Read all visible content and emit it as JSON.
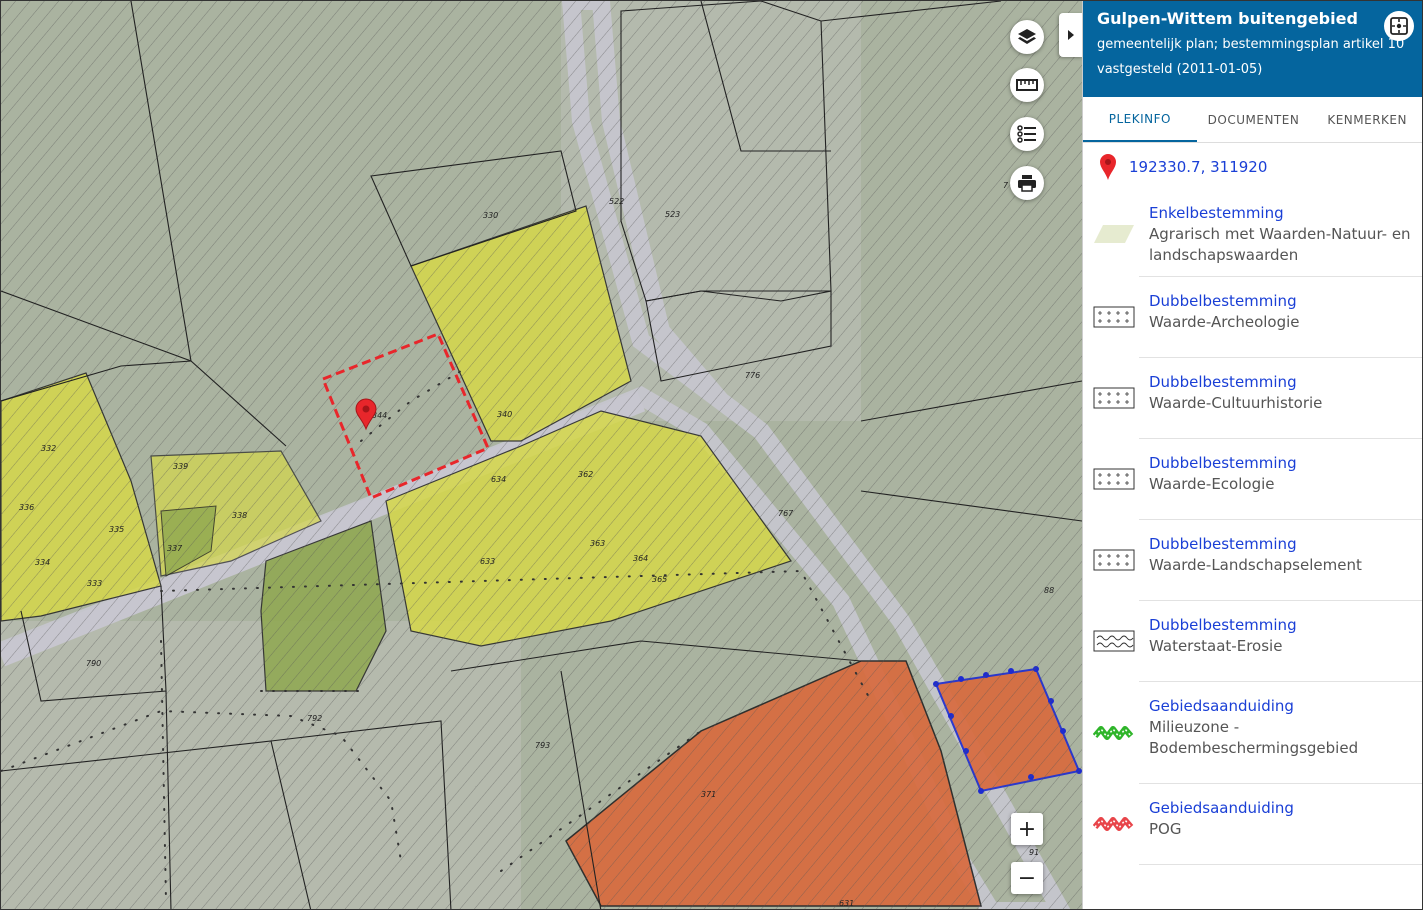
{
  "plan": {
    "title": "Gulpen-Wittem buitengebied",
    "subtitle": "gemeentelijk plan; bestemmingsplan artikel 10",
    "status": "vastgesteld (2011-01-05)"
  },
  "tabs": [
    {
      "label": "PLEKINFO",
      "active": true
    },
    {
      "label": "DOCUMENTEN",
      "active": false
    },
    {
      "label": "KENMERKEN",
      "active": false
    }
  ],
  "location": {
    "coordinates": "192330.7, 311920"
  },
  "entries": [
    {
      "title": "Enkelbestemming",
      "desc": "Agrarisch met Waarden-Natuur- en landschapswaarden",
      "legend": "agrarisch-swatch"
    },
    {
      "title": "Dubbelbestemming",
      "desc": "Waarde-Archeologie",
      "legend": "plus-grid"
    },
    {
      "title": "Dubbelbestemming",
      "desc": "Waarde-Cultuurhistorie",
      "legend": "plus-grid"
    },
    {
      "title": "Dubbelbestemming",
      "desc": "Waarde-Ecologie",
      "legend": "plus-grid"
    },
    {
      "title": "Dubbelbestemming",
      "desc": "Waarde-Landschapselement",
      "legend": "plus-grid"
    },
    {
      "title": "Dubbelbestemming",
      "desc": "Waterstaat-Erosie",
      "legend": "wave-box"
    },
    {
      "title": "Gebiedsaanduiding",
      "desc": "Milieuzone - Bodembeschermingsgebied",
      "legend": "green-zigzag"
    },
    {
      "title": "Gebiedsaanduiding",
      "desc": "POG",
      "legend": "red-zigzag"
    }
  ],
  "map": {
    "parcel_labels": [
      "330",
      "522",
      "523",
      "340",
      "344",
      "332",
      "339",
      "336",
      "335",
      "338",
      "337",
      "334",
      "333",
      "634",
      "362",
      "363",
      "364",
      "365",
      "633",
      "776",
      "767",
      "790",
      "792",
      "793",
      "371",
      "88",
      "91",
      "631",
      "7"
    ],
    "controls": {
      "zoom_in": "+",
      "zoom_out": "−"
    },
    "icons": [
      "layers-icon",
      "ruler-icon",
      "legend-list-icon",
      "print-icon"
    ]
  },
  "colors": {
    "header": "#05659e",
    "link": "#1a3fd6",
    "marker": "#e8262b",
    "agrarisch": "#e6ebd0",
    "wonen": "#d6d84a",
    "tuin": "#8fa850",
    "bedrijf": "#d9693c"
  }
}
